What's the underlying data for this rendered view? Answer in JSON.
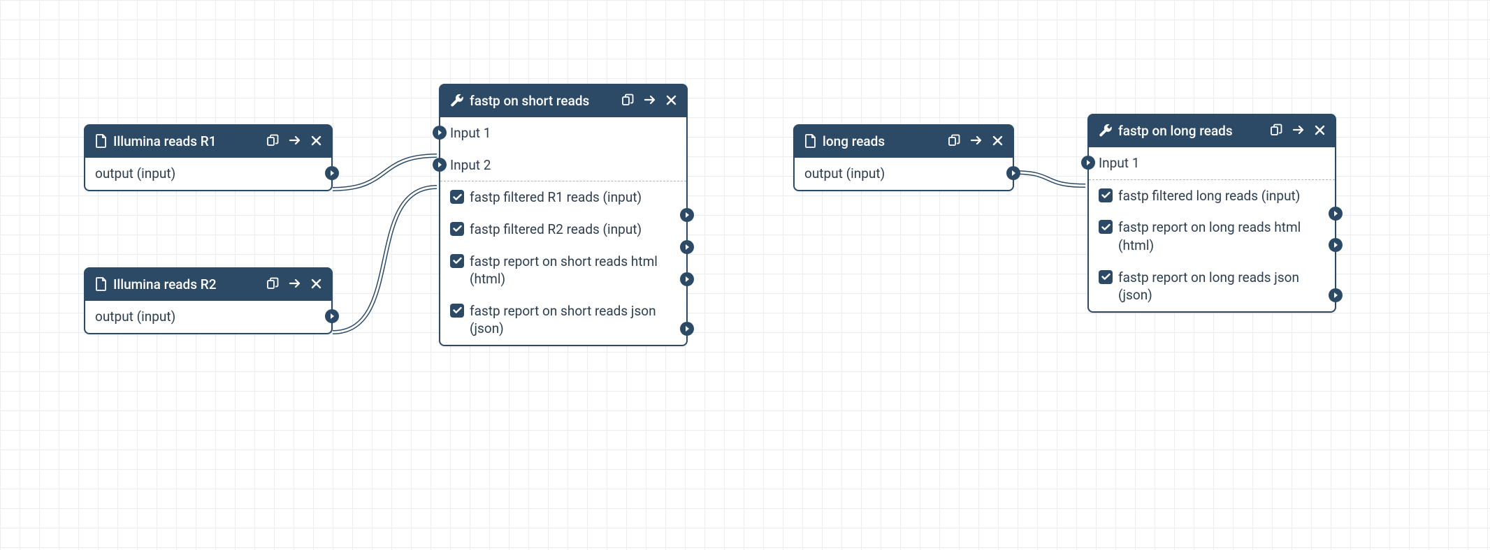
{
  "colors": {
    "primary": "#2c4a66",
    "grid": "#eaedf0",
    "text": "#2c3e50"
  },
  "nodes": {
    "illumina_r1": {
      "title": "Illumina reads R1",
      "type": "file",
      "rows": {
        "output": "output (input)"
      }
    },
    "illumina_r2": {
      "title": "Illumina reads R2",
      "type": "file",
      "rows": {
        "output": "output (input)"
      }
    },
    "fastp_short": {
      "title": "fastp on short reads",
      "type": "tool",
      "inputs": {
        "in1": "Input 1",
        "in2": "Input 2"
      },
      "outputs": {
        "o1": "fastp filtered R1 reads (input)",
        "o2": "fastp filtered R2 reads (input)",
        "o3": "fastp report on short reads html (html)",
        "o4": "fastp report on short reads json (json)"
      }
    },
    "long_reads": {
      "title": "long reads",
      "type": "file",
      "rows": {
        "output": "output (input)"
      }
    },
    "fastp_long": {
      "title": "fastp on long reads",
      "type": "tool",
      "inputs": {
        "in1": "Input 1"
      },
      "outputs": {
        "o1": "fastp filtered long reads (input)",
        "o2": "fastp report on long reads html (html)",
        "o3": "fastp report on long reads json (json)"
      }
    }
  },
  "edges": [
    {
      "from": "illumina_r1.output",
      "to": "fastp_short.in1"
    },
    {
      "from": "illumina_r2.output",
      "to": "fastp_short.in2"
    },
    {
      "from": "long_reads.output",
      "to": "fastp_long.in1"
    }
  ]
}
